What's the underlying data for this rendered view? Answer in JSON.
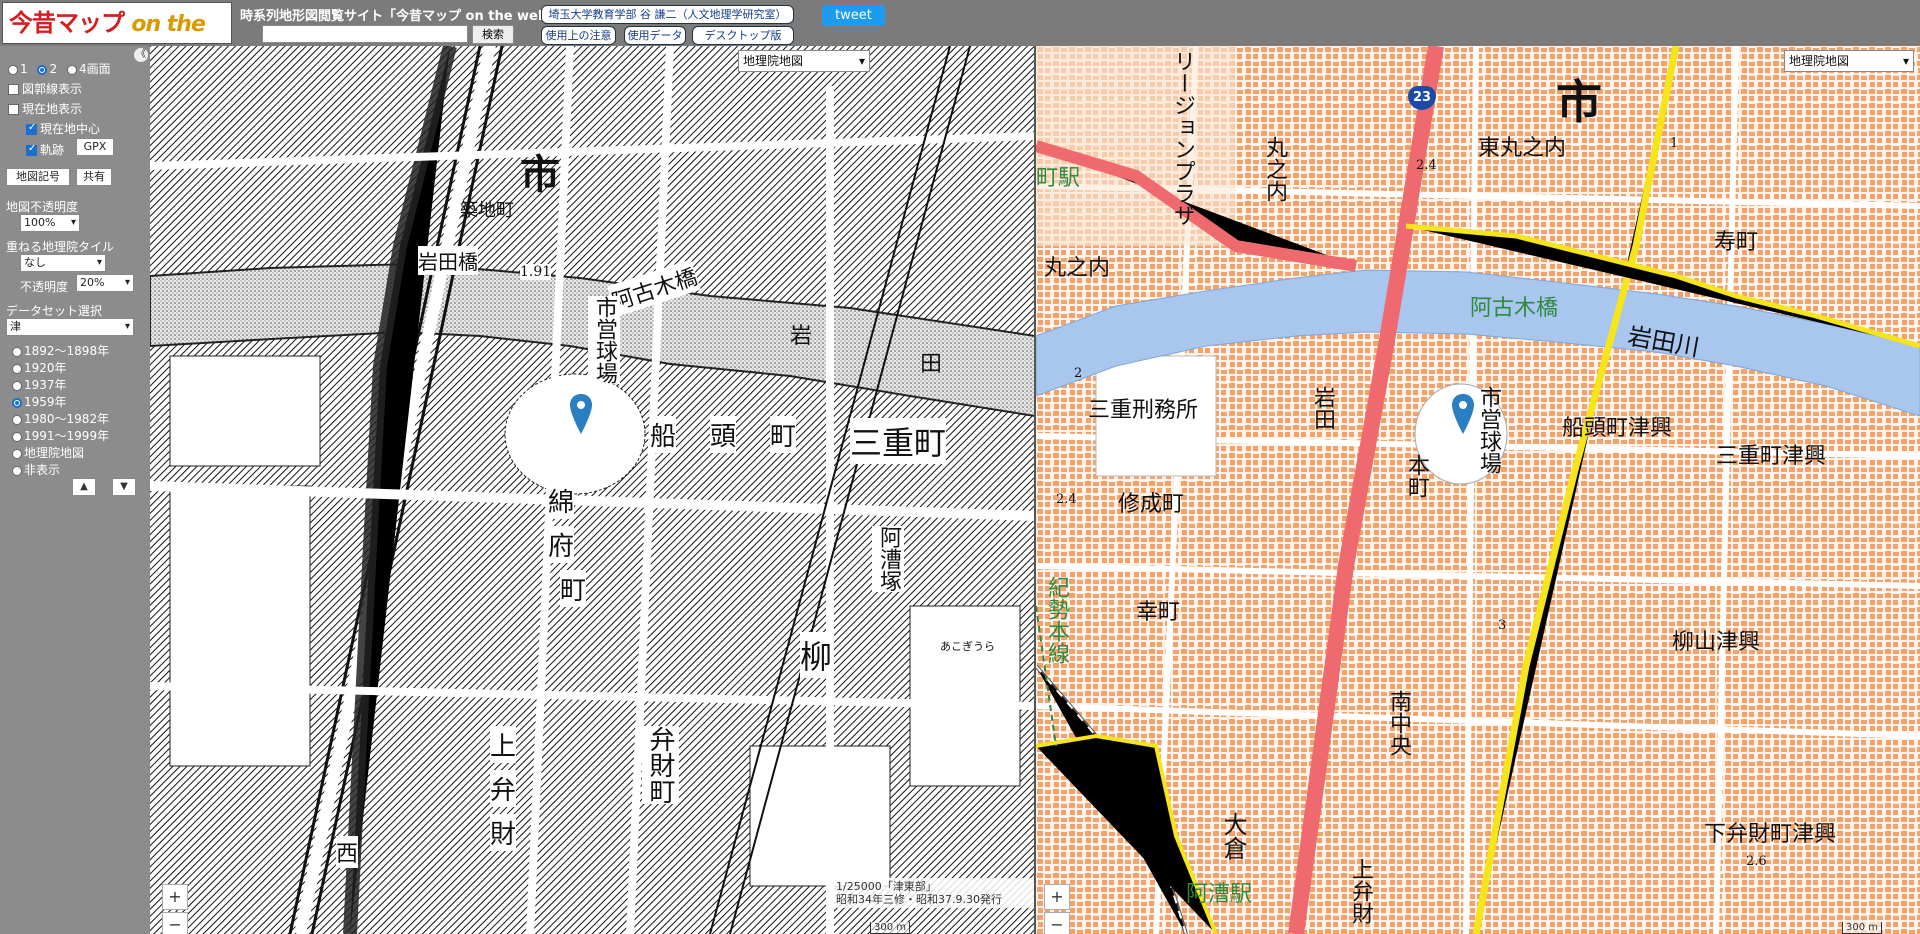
{
  "header": {
    "logo_jp": "今昔マップ",
    "logo_en": "on the web",
    "site_title": "時系列地形図閲覧サイト「今昔マップ on the web」",
    "search_placeholder": "",
    "search_label": "検索",
    "author_label": "埼玉大学教育学部 谷 謙二（人文地理学研究室）",
    "notes_label": "使用上の注意",
    "data_label": "使用データ",
    "desktop_label": "デスクトップ版",
    "tweet_label": "tweet"
  },
  "panel": {
    "collapse_glyph": "《",
    "view_options": [
      "1",
      "2",
      "4画面"
    ],
    "view_selected": 1,
    "grid_label": "図郭線表示",
    "grid_checked": false,
    "current_label": "現在地表示",
    "current_checked": false,
    "center_label": "現在地中心",
    "center_checked": true,
    "track_label": "軌跡",
    "track_checked": true,
    "gpx_label": "GPX",
    "symbols_label": "地図記号",
    "share_label": "共有",
    "opacity_label": "地図不透明度",
    "opacity_value": "100%",
    "overlay_label": "重ねる地理院タイル",
    "overlay_value": "なし",
    "overlay_opacity_label": "不透明度",
    "overlay_opacity_value": "20%",
    "dataset_label": "データセット選択",
    "dataset_value": "津",
    "eras": [
      "1892～1898年",
      "1920年",
      "1937年",
      "1959年",
      "1980～1982年",
      "1991～1999年",
      "地理院地図",
      "非表示"
    ],
    "era_selected": 3,
    "up_glyph": "▲",
    "down_glyph": "▼"
  },
  "left_map": {
    "layer_select": "地理院地図",
    "labels": {
      "city_big": "市",
      "tsukiji": "築地町",
      "iwatabashi": "岩田橋",
      "akogibashi": "阿古木橋",
      "iwa": "岩",
      "ta": "田",
      "funa": "船",
      "atama": "頭",
      "machi1": "町",
      "mie_machi": "三重町",
      "shiei": "市営球場",
      "watafu": "綿",
      "fu": "府",
      "machi2": "町",
      "akogi_zuka": "阿漕塚",
      "yanagi": "柳",
      "benzai": "弁財町",
      "kami": "上",
      "ben": "弁",
      "zai": "財",
      "ni": "西",
      "height": "1.91",
      "akogiura": "あこぎうら"
    },
    "zoom_in": "+",
    "zoom_out": "−",
    "credit_line1": "1/25000「津東部」",
    "credit_line2": "昭和34年三修・昭和37.9.30発行",
    "scale": "300 m"
  },
  "right_map": {
    "layer_select": "地理院地図",
    "labels": {
      "city_big": "市",
      "route": "23",
      "higashi_marunouchi": "東丸之内",
      "marunouchi_v": "丸之内",
      "marunouchi": "丸之内",
      "region_plaza": "リージョンプラザ",
      "kotobuki": "寿町",
      "akogibashi": "阿古木橋",
      "iwatagawa": "岩田川",
      "mie_keimusho": "三重刑務所",
      "iwata": "岩田",
      "shiei": "市営球場",
      "honmachi": "本町",
      "funato": "船頭町津興",
      "mie_machi": "三重町津興",
      "shusei": "修成町",
      "saiwai": "幸町",
      "yanagiyama": "柳山津興",
      "minami_chuo": "南中央",
      "okura": "大倉",
      "akogi_eki": "阿漕駅",
      "shimobenzai": "下弁財町津興",
      "kamiben": "上弁財",
      "machi_eki": "町駅",
      "kisei": "紀勢本線",
      "h1": "2.4",
      "h2": "2.4",
      "h3": "3",
      "h4": "2.6",
      "h5": "2",
      "h6": "1"
    },
    "zoom_in": "+",
    "zoom_out": "−",
    "scale": "300 m"
  },
  "colors": {
    "river": "#a9c7ee",
    "road_red": "#ee6a6e",
    "road_yellow": "#f5e51a",
    "building": "#f3a26b",
    "header_bg": "#7b7b7b"
  }
}
